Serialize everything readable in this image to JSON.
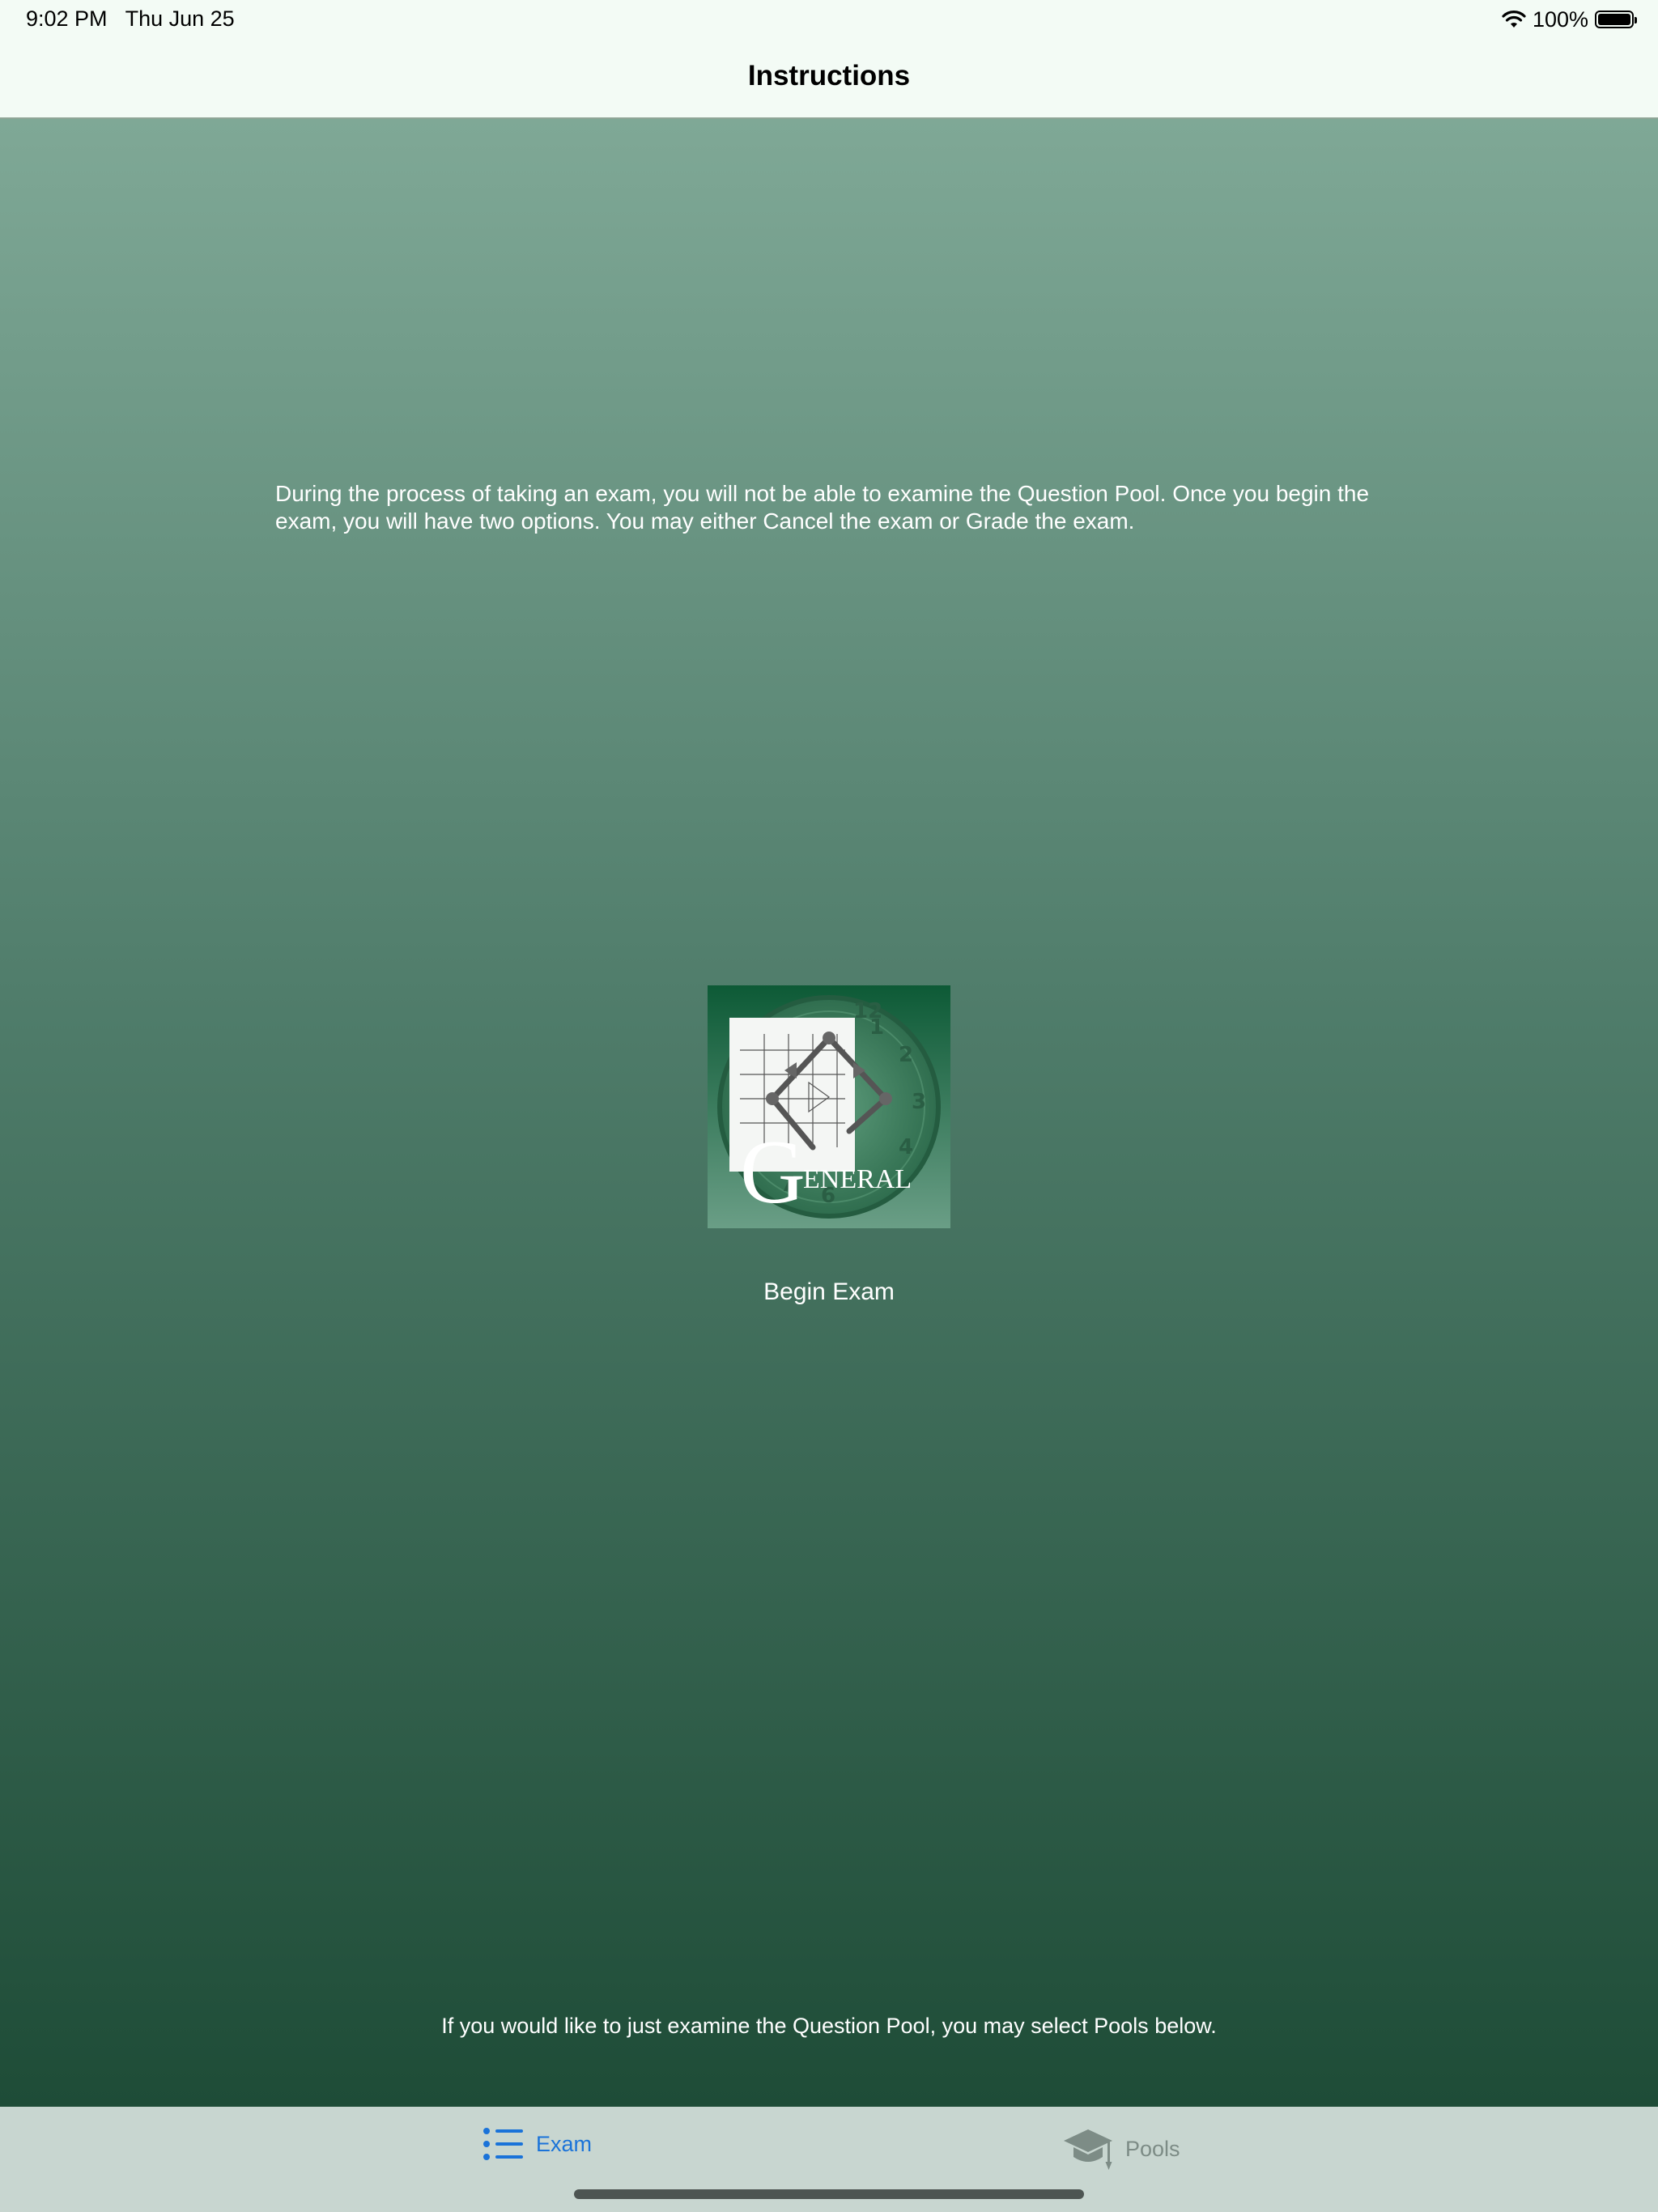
{
  "status_bar": {
    "time": "9:02 PM",
    "date": "Thu Jun 25",
    "battery_percent": "100%",
    "battery_level": 1.0,
    "wifi_icon": "wifi-icon",
    "battery_icon": "battery-icon"
  },
  "nav": {
    "title": "Instructions"
  },
  "main": {
    "instructions": "During the process of taking an exam, you will not be able to examine the Question Pool. Once you begin the exam, you will have two options. You may either Cancel the exam or Grade the exam.",
    "logo": {
      "big_letter": "G",
      "rest_text": "ENERAL",
      "colors": {
        "background_top": "#0d5a36",
        "background_bottom": "#6a9e86"
      }
    },
    "begin_exam_label": "Begin Exam",
    "pools_hint": "If you would like to just examine the Question Pool, you may select Pools below."
  },
  "tabbar": {
    "tabs": [
      {
        "label": "Exam",
        "icon": "list-icon",
        "selected": true
      },
      {
        "label": "Pools",
        "icon": "graduation-cap-icon",
        "selected": false
      }
    ],
    "colors": {
      "selected": "#1a73d9",
      "unselected": "#7d8c86"
    }
  }
}
